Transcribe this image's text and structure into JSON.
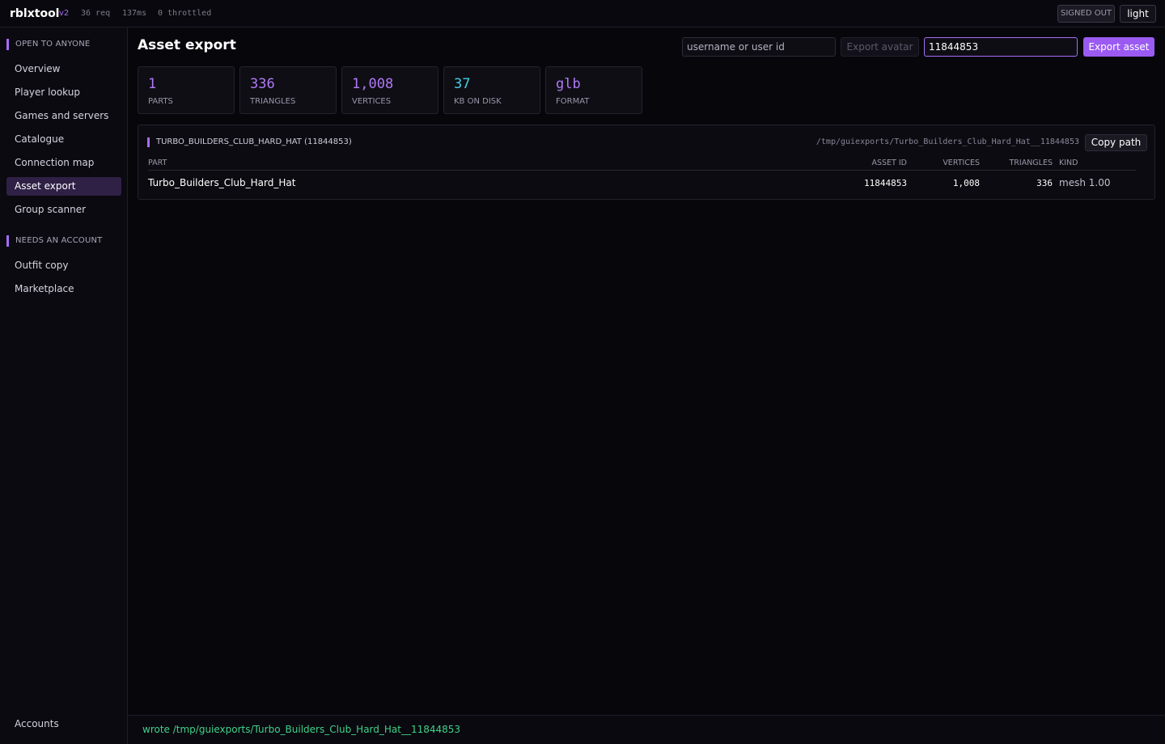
{
  "topbar": {
    "brand": "rblxtool",
    "version": "v2",
    "requests": "36 req",
    "latency": "137ms",
    "throttled": "0 throttled",
    "auth_status": "SIGNED OUT",
    "theme_toggle": "light"
  },
  "sidebar": {
    "sections": [
      {
        "heading": "OPEN TO ANYONE",
        "items": [
          {
            "label": "Overview"
          },
          {
            "label": "Player lookup"
          },
          {
            "label": "Games and servers"
          },
          {
            "label": "Catalogue"
          },
          {
            "label": "Connection map"
          },
          {
            "label": "Asset export",
            "active": true
          },
          {
            "label": "Group scanner"
          }
        ]
      },
      {
        "heading": "NEEDS AN ACCOUNT",
        "items": [
          {
            "label": "Outfit copy"
          },
          {
            "label": "Marketplace"
          }
        ]
      }
    ],
    "footer_item": "Accounts"
  },
  "main": {
    "title": "Asset export",
    "user_input": {
      "value": "",
      "placeholder": "username or user id"
    },
    "export_avatar_label": "Export avatar",
    "asset_input": {
      "value": "11844853"
    },
    "export_asset_label": "Export asset",
    "stats": [
      {
        "value": "1",
        "label": "PARTS",
        "color": "#b07af7"
      },
      {
        "value": "336",
        "label": "TRIANGLES",
        "color": "#b07af7"
      },
      {
        "value": "1,008",
        "label": "VERTICES",
        "color": "#b07af7"
      },
      {
        "value": "37",
        "label": "KB ON DISK",
        "color": "#3fd0e6"
      },
      {
        "value": "glb",
        "label": "FORMAT",
        "color": "#b07af7"
      }
    ],
    "result": {
      "title": "TURBO_BUILDERS_CLUB_HARD_HAT (11844853)",
      "path": "/tmp/guiexports/Turbo_Builders_Club_Hard_Hat__11844853",
      "copy_label": "Copy path",
      "columns": [
        "PART",
        "ASSET ID",
        "VERTICES",
        "TRIANGLES",
        "KIND"
      ],
      "rows": [
        {
          "part": "Turbo_Builders_Club_Hard_Hat",
          "asset_id": "11844853",
          "vertices": "1,008",
          "triangles": "336",
          "kind": "mesh 1.00"
        }
      ]
    }
  },
  "status": {
    "message": "wrote /tmp/guiexports/Turbo_Builders_Club_Hard_Hat__11844853",
    "color": "#3fd28a"
  }
}
